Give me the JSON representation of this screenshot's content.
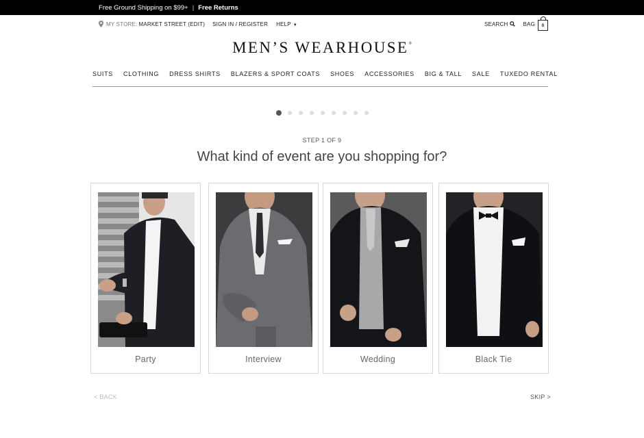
{
  "promo": {
    "shipping": "Free Ground Shipping on $99+",
    "separator": "|",
    "returns": "Free Returns"
  },
  "utility": {
    "store_label": "MY STORE:",
    "store_name": "MARKET STREET (EDIT)",
    "sign_in": "SIGN IN / REGISTER",
    "help": "HELP",
    "search": "SEARCH",
    "bag": "BAG",
    "bag_count": "0"
  },
  "logo": {
    "text": "MEN’S WEARHOUSE",
    "mark": "®"
  },
  "nav": {
    "items": [
      {
        "label": "SUITS"
      },
      {
        "label": "CLOTHING"
      },
      {
        "label": "DRESS SHIRTS"
      },
      {
        "label": "BLAZERS & SPORT COATS"
      },
      {
        "label": "SHOES"
      },
      {
        "label": "ACCESSORIES"
      },
      {
        "label": "BIG & TALL"
      },
      {
        "label": "SALE"
      },
      {
        "label": "TUXEDO RENTAL"
      }
    ]
  },
  "quiz": {
    "current_step": 1,
    "total_steps": 9,
    "step_label": "STEP 1 OF 9",
    "question": "What kind of event are you shopping for?",
    "options": [
      {
        "label": "Party",
        "image": "man-in-black-blazer-checking-watch-photo"
      },
      {
        "label": "Interview",
        "image": "man-in-grey-suit-seated-photo"
      },
      {
        "label": "Wedding",
        "image": "man-in-black-tux-with-grey-vest-photo"
      },
      {
        "label": "Black Tie",
        "image": "man-in-black-tuxedo-bow-tie-photo"
      }
    ],
    "back": "< BACK",
    "skip": "SKIP >"
  },
  "colors": {
    "promo_bg": "#000000",
    "accent_dot": "#555555",
    "inactive_dot": "#dddddd",
    "back_disabled": "#bbbbbb"
  }
}
